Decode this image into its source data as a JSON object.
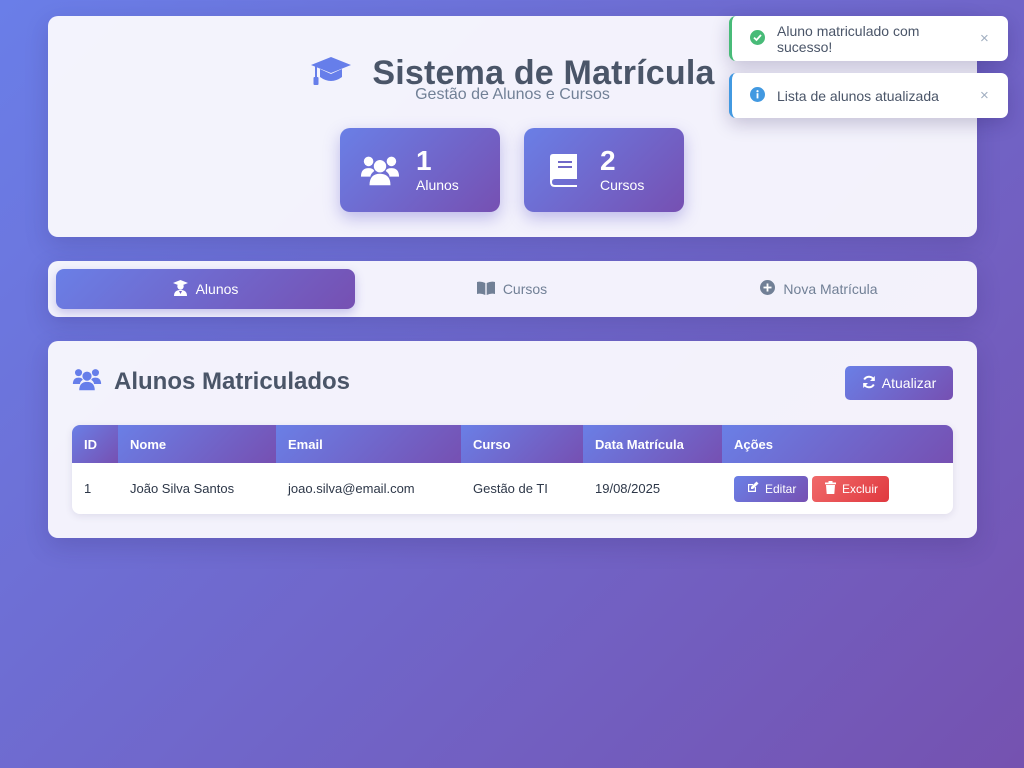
{
  "header": {
    "title": "Sistema de Matrícula",
    "subtitle": "Gestão de Alunos e Cursos",
    "icon": "graduation-cap-icon",
    "stats": [
      {
        "value": "1",
        "label": "Alunos",
        "icon": "users-icon"
      },
      {
        "value": "2",
        "label": "Cursos",
        "icon": "book-icon"
      }
    ]
  },
  "tabs": [
    {
      "label": "Alunos",
      "icon": "user-graduate-icon",
      "active": true
    },
    {
      "label": "Cursos",
      "icon": "book-open-icon",
      "active": false
    },
    {
      "label": "Nova Matrícula",
      "icon": "plus-circle-icon",
      "active": false
    }
  ],
  "section": {
    "title": "Alunos Matriculados",
    "icon": "users-icon",
    "refresh_label": "Atualizar"
  },
  "table": {
    "columns": [
      "ID",
      "Nome",
      "Email",
      "Curso",
      "Data Matrícula",
      "Ações"
    ],
    "rows": [
      {
        "id": "1",
        "nome": "João Silva Santos",
        "email": "joao.silva@email.com",
        "curso": "Gestão de TI",
        "data": "19/08/2025"
      }
    ],
    "edit_label": "Editar",
    "delete_label": "Excluir"
  },
  "toasts": [
    {
      "type": "success",
      "message": "Aluno matriculado com sucesso!",
      "close": "×"
    },
    {
      "type": "info",
      "message": "Lista de alunos atualizada",
      "close": "×"
    }
  ],
  "colors": {
    "accent_start": "#6a7fe6",
    "accent_end": "#7650b2",
    "success": "#48bb78",
    "info": "#4299e1",
    "danger": "#e0393f"
  }
}
